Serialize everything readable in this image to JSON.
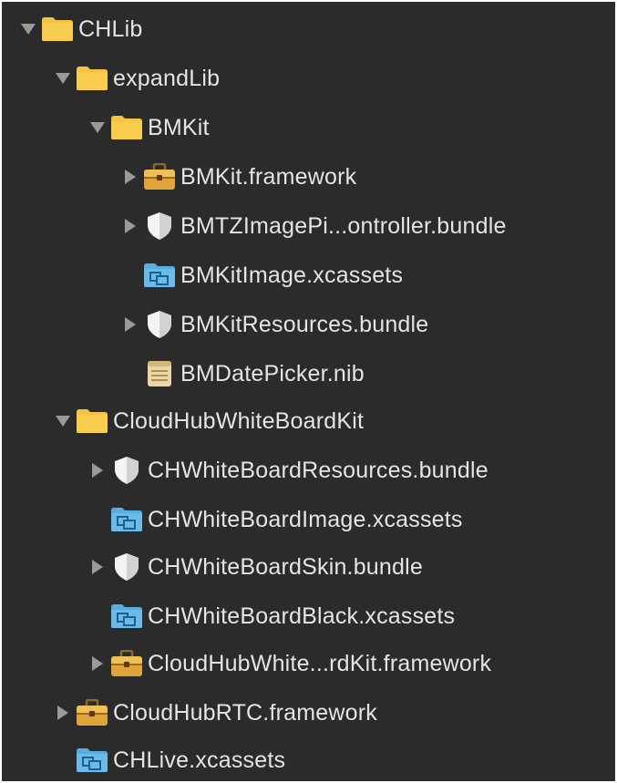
{
  "tree": {
    "items": [
      {
        "label": "CHLib",
        "icon": "folder-icon",
        "disclosure": "expanded"
      },
      {
        "label": "expandLib",
        "icon": "folder-icon",
        "disclosure": "expanded"
      },
      {
        "label": "BMKit",
        "icon": "folder-icon",
        "disclosure": "expanded"
      },
      {
        "label": "BMKit.framework",
        "icon": "framework-toolbox-icon",
        "disclosure": "collapsed"
      },
      {
        "label": "BMTZImagePi...ontroller.bundle",
        "icon": "bundle-shield-icon",
        "disclosure": "collapsed"
      },
      {
        "label": "BMKitImage.xcassets",
        "icon": "asset-catalog-icon",
        "disclosure": "none"
      },
      {
        "label": "BMKitResources.bundle",
        "icon": "bundle-shield-icon",
        "disclosure": "collapsed"
      },
      {
        "label": "BMDatePicker.nib",
        "icon": "nib-file-icon",
        "disclosure": "none"
      },
      {
        "label": "CloudHubWhiteBoardKit",
        "icon": "folder-icon",
        "disclosure": "expanded"
      },
      {
        "label": "CHWhiteBoardResources.bundle",
        "icon": "bundle-shield-icon",
        "disclosure": "collapsed"
      },
      {
        "label": "CHWhiteBoardImage.xcassets",
        "icon": "asset-catalog-icon",
        "disclosure": "none"
      },
      {
        "label": "CHWhiteBoardSkin.bundle",
        "icon": "bundle-shield-icon",
        "disclosure": "collapsed"
      },
      {
        "label": "CHWhiteBoardBlack.xcassets",
        "icon": "asset-catalog-icon",
        "disclosure": "none"
      },
      {
        "label": "CloudHubWhite...rdKit.framework",
        "icon": "framework-toolbox-icon",
        "disclosure": "collapsed"
      },
      {
        "label": "CloudHubRTC.framework",
        "icon": "framework-toolbox-icon",
        "disclosure": "collapsed"
      },
      {
        "label": "CHLive.xcassets",
        "icon": "asset-catalog-icon",
        "disclosure": "none"
      }
    ]
  },
  "colors": {
    "background": "#2b2b2c",
    "text": "#e4e4e4",
    "folder": "#f5c242",
    "asset_catalog": "#57aee0",
    "disclosure": "#9a9a9a"
  }
}
